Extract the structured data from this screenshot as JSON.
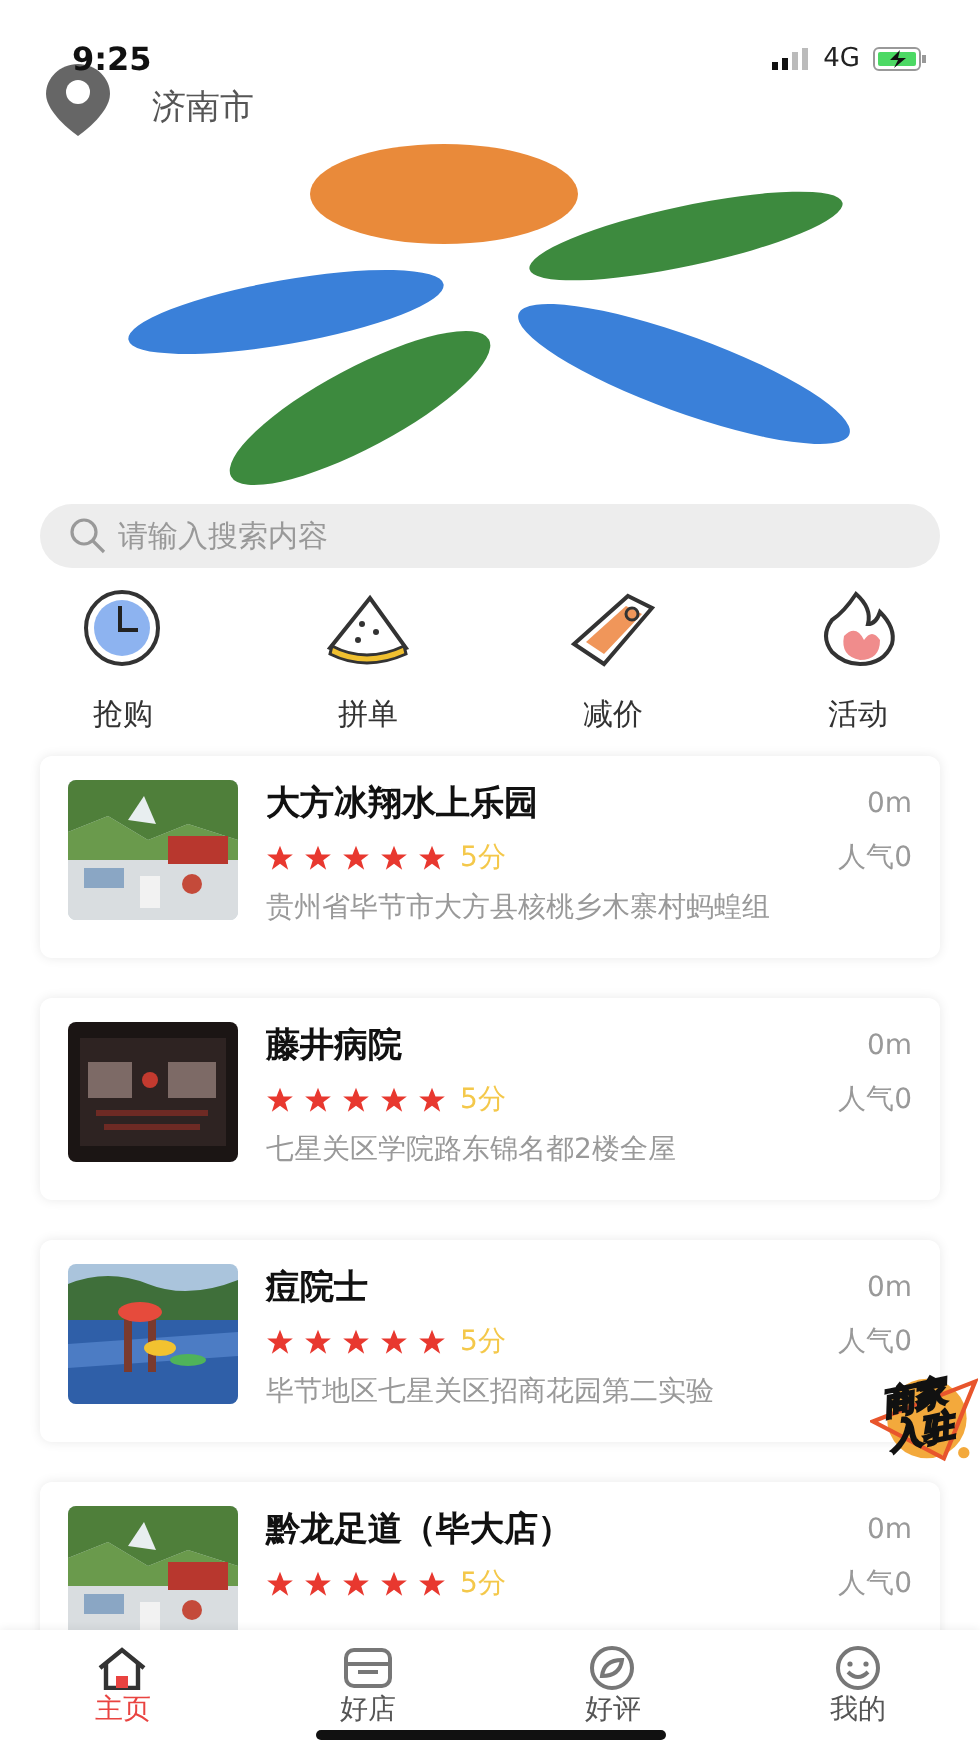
{
  "status_bar": {
    "time": "9:25",
    "network": "4G"
  },
  "header": {
    "city": "济南市"
  },
  "search": {
    "placeholder": "请输入搜索内容"
  },
  "categories": [
    {
      "label": "抢购",
      "kind": "clock"
    },
    {
      "label": "拼单",
      "kind": "slice"
    },
    {
      "label": "减价",
      "kind": "tag"
    },
    {
      "label": "活动",
      "kind": "flame"
    }
  ],
  "shops": [
    {
      "name": "大方冰翔水上乐园",
      "distance": "0m",
      "stars": 5,
      "score": "5分",
      "popularity": "人气0",
      "address": "贵州省毕节市大方县核桃乡木寨村蚂蝗组"
    },
    {
      "name": "藤井病院",
      "distance": "0m",
      "stars": 5,
      "score": "5分",
      "popularity": "人气0",
      "address": "七星关区学院路东锦名都2楼全屋"
    },
    {
      "name": "痘院士",
      "distance": "0m",
      "stars": 5,
      "score": "5分",
      "popularity": "人气0",
      "address": "毕节地区七星关区招商花园第二实验"
    },
    {
      "name": "黔龙足道（毕大店）",
      "distance": "0m",
      "stars": 5,
      "score": "5分",
      "popularity": "人气0"
    }
  ],
  "join_badge": {
    "label": "商家入驻"
  },
  "tabs": [
    {
      "label": "主页",
      "kind": "home",
      "selected": true
    },
    {
      "label": "好店",
      "kind": "shop",
      "selected": false
    },
    {
      "label": "好评",
      "kind": "review",
      "selected": false
    },
    {
      "label": "我的",
      "kind": "me",
      "selected": false
    }
  ]
}
